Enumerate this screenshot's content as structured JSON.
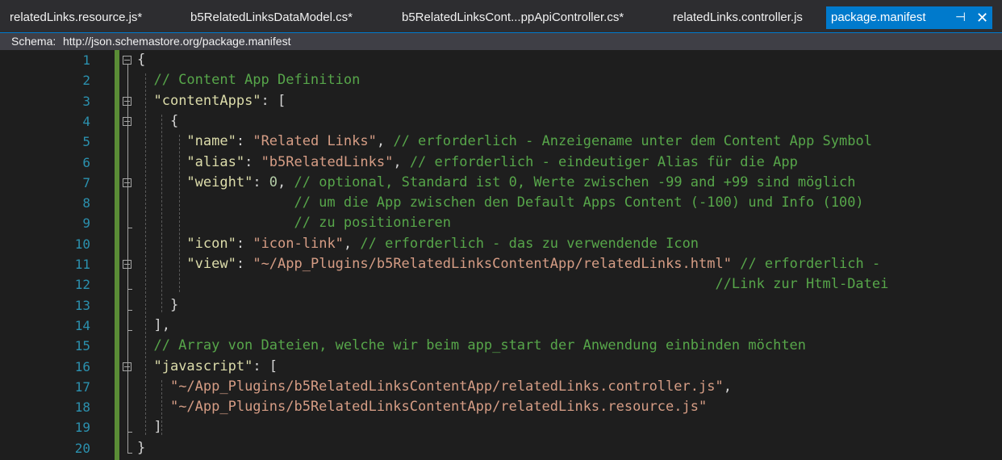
{
  "tabs": [
    {
      "label": "relatedLinks.resource.js*",
      "active": false
    },
    {
      "label": "b5RelatedLinksDataModel.cs*",
      "active": false
    },
    {
      "label": "b5RelatedLinksCont...ppApiController.cs*",
      "active": false
    },
    {
      "label": "relatedLinks.controller.js",
      "active": false
    },
    {
      "label": "package.manifest",
      "active": true
    }
  ],
  "tab_icons": {
    "pin": "pin-icon",
    "close": "close-icon"
  },
  "schema": {
    "label": "Schema:",
    "url": "http://json.schemastore.org/package.manifest"
  },
  "line_numbers": [
    "1",
    "2",
    "3",
    "4",
    "5",
    "6",
    "7",
    "8",
    "9",
    "10",
    "11",
    "12",
    "13",
    "14",
    "15",
    "16",
    "17",
    "18",
    "19",
    "20"
  ],
  "code_lines": [
    [
      {
        "t": "{",
        "c": "p"
      }
    ],
    [
      {
        "t": "  // Content App Definition",
        "c": "c"
      }
    ],
    [
      {
        "t": "  ",
        "c": "p"
      },
      {
        "t": "\"contentApps\"",
        "c": "k"
      },
      {
        "t": ": [",
        "c": "p"
      }
    ],
    [
      {
        "t": "    {",
        "c": "p"
      }
    ],
    [
      {
        "t": "      ",
        "c": "p"
      },
      {
        "t": "\"name\"",
        "c": "k"
      },
      {
        "t": ": ",
        "c": "p"
      },
      {
        "t": "\"Related Links\"",
        "c": "s"
      },
      {
        "t": ", ",
        "c": "p"
      },
      {
        "t": "// erforderlich - Anzeigename unter dem Content App Symbol",
        "c": "c"
      }
    ],
    [
      {
        "t": "      ",
        "c": "p"
      },
      {
        "t": "\"alias\"",
        "c": "k"
      },
      {
        "t": ": ",
        "c": "p"
      },
      {
        "t": "\"b5RelatedLinks\"",
        "c": "s"
      },
      {
        "t": ", ",
        "c": "p"
      },
      {
        "t": "// erforderlich - eindeutiger Alias für die App",
        "c": "c"
      }
    ],
    [
      {
        "t": "      ",
        "c": "p"
      },
      {
        "t": "\"weight\"",
        "c": "k"
      },
      {
        "t": ": ",
        "c": "p"
      },
      {
        "t": "0",
        "c": "n"
      },
      {
        "t": ", ",
        "c": "p"
      },
      {
        "t": "// optional, Standard ist 0, Werte zwischen -99 and +99 sind möglich",
        "c": "c"
      }
    ],
    [
      {
        "t": "                   // um die App zwischen den Default Apps Content (-100) und Info (100)",
        "c": "c"
      }
    ],
    [
      {
        "t": "                   // zu positionieren",
        "c": "c"
      }
    ],
    [
      {
        "t": "      ",
        "c": "p"
      },
      {
        "t": "\"icon\"",
        "c": "k"
      },
      {
        "t": ": ",
        "c": "p"
      },
      {
        "t": "\"icon-link\"",
        "c": "s"
      },
      {
        "t": ", ",
        "c": "p"
      },
      {
        "t": "// erforderlich - das zu verwendende Icon",
        "c": "c"
      }
    ],
    [
      {
        "t": "      ",
        "c": "p"
      },
      {
        "t": "\"view\"",
        "c": "k"
      },
      {
        "t": ": ",
        "c": "p"
      },
      {
        "t": "\"~/App_Plugins/b5RelatedLinksContentApp/relatedLinks.html\"",
        "c": "s"
      },
      {
        "t": " ",
        "c": "p"
      },
      {
        "t": "// erforderlich -",
        "c": "c"
      }
    ],
    [
      {
        "t": "                                                                      //Link zur Html-Datei",
        "c": "c"
      }
    ],
    [
      {
        "t": "    }",
        "c": "p"
      }
    ],
    [
      {
        "t": "  ],",
        "c": "p"
      }
    ],
    [
      {
        "t": "  // Array von Dateien, welche wir beim app_start der Anwendung einbinden möchten",
        "c": "c"
      }
    ],
    [
      {
        "t": "  ",
        "c": "p"
      },
      {
        "t": "\"javascript\"",
        "c": "k"
      },
      {
        "t": ": [",
        "c": "p"
      }
    ],
    [
      {
        "t": "    ",
        "c": "p"
      },
      {
        "t": "\"~/App_Plugins/b5RelatedLinksContentApp/relatedLinks.controller.js\"",
        "c": "s"
      },
      {
        "t": ",",
        "c": "p"
      }
    ],
    [
      {
        "t": "    ",
        "c": "p"
      },
      {
        "t": "\"~/App_Plugins/b5RelatedLinksContentApp/relatedLinks.resource.js\"",
        "c": "s"
      }
    ],
    [
      {
        "t": "  ]",
        "c": "p"
      }
    ],
    [
      {
        "t": "}",
        "c": "p"
      }
    ]
  ],
  "fold_lines": [
    1,
    3,
    4,
    7,
    11,
    16
  ],
  "colors": {
    "accent": "#007acc",
    "background": "#1e1e1e",
    "line_number": "#2b91af",
    "comment": "#57a64a",
    "property": "#dcdcaa",
    "string": "#d69d85",
    "change_bar": "#5a8c36"
  }
}
